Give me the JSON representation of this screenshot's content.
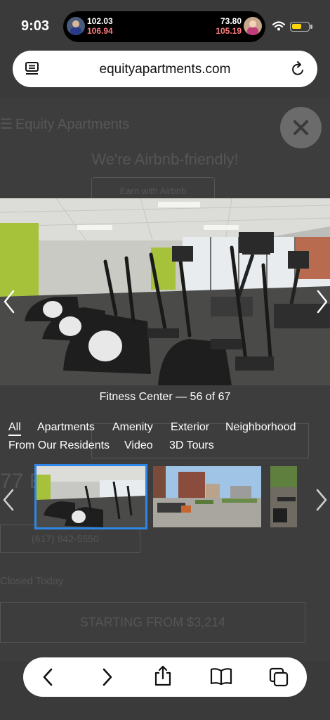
{
  "status": {
    "time": "9:03",
    "ticker_left": {
      "up": "102.03",
      "down": "106.94"
    },
    "ticker_right": {
      "up": "73.80",
      "down": "105.19"
    }
  },
  "browser": {
    "url": "equityapartments.com"
  },
  "background_page": {
    "brand": "Equity Apartments",
    "promo": "We're Airbnb-friendly!",
    "airbnb_button": "Earn with Airbnb",
    "price_fragment": "77 B",
    "phone": "(617) 842-5550",
    "today": "Closed Today",
    "starting": "STARTING FROM $3,214"
  },
  "gallery": {
    "caption": "Fitness Center — 56 of 67",
    "tabs_row1": [
      "All",
      "Apartments",
      "Amenity",
      "Exterior",
      "Neighborhood"
    ],
    "tabs_row2": [
      "From Our Residents",
      "Video",
      "3D Tours"
    ],
    "active_tab": "All"
  },
  "colors": {
    "selection": "#2f86e6",
    "battery": "#ffd60a",
    "ticker_down": "#ff7b7b"
  },
  "icons": {
    "close": "close-icon",
    "prev": "chevron-left-icon",
    "next": "chevron-right-icon",
    "back": "back-icon",
    "forward": "forward-icon",
    "share": "share-icon",
    "bookmarks": "book-icon",
    "tabs": "tabs-icon"
  }
}
